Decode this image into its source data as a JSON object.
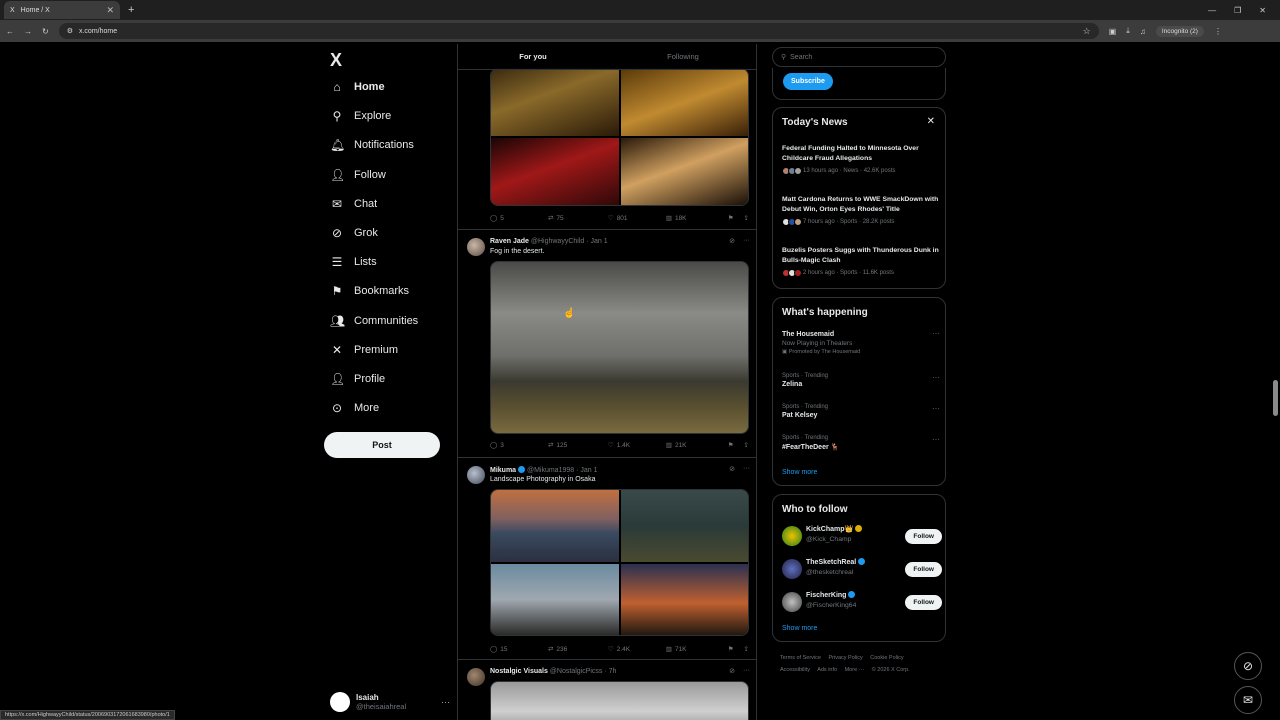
{
  "browser": {
    "tab_title": "Home / X",
    "tab_icon": "X",
    "url": "x.com/home",
    "incognito_label": "Incognito (2)",
    "status_url": "https://x.com/HighwayyChild/status/2006903172061683980/photo/1"
  },
  "nav": {
    "logo": "X",
    "items": [
      {
        "label": "Home",
        "icon": "home-icon",
        "glyph": "⌂"
      },
      {
        "label": "Explore",
        "icon": "search-icon",
        "glyph": "⚲"
      },
      {
        "label": "Notifications",
        "icon": "bell-icon",
        "glyph": "🔔︎"
      },
      {
        "label": "Follow",
        "icon": "person-add-icon",
        "glyph": "👤︎"
      },
      {
        "label": "Chat",
        "icon": "mail-icon",
        "glyph": "✉"
      },
      {
        "label": "Grok",
        "icon": "grok-icon",
        "glyph": "⊘"
      },
      {
        "label": "Lists",
        "icon": "list-icon",
        "glyph": "☰"
      },
      {
        "label": "Bookmarks",
        "icon": "bookmark-icon",
        "glyph": "⚑"
      },
      {
        "label": "Communities",
        "icon": "communities-icon",
        "glyph": "👥︎"
      },
      {
        "label": "Premium",
        "icon": "x-premium-icon",
        "glyph": "✕"
      },
      {
        "label": "Profile",
        "icon": "profile-icon",
        "glyph": "👤︎"
      },
      {
        "label": "More",
        "icon": "more-circle-icon",
        "glyph": "⊙"
      }
    ],
    "post_label": "Post",
    "account": {
      "name": "Isaiah",
      "handle": "@theisaiahreal"
    }
  },
  "feed": {
    "tabs": [
      "For you",
      "Following"
    ],
    "post0": {
      "replies": "5",
      "reposts": "75",
      "likes": "801",
      "views": "18K"
    },
    "post1": {
      "name": "Raven Jade",
      "handle": "@HighwayyChild",
      "date": "· Jan 1",
      "text": "Fog in the desert.",
      "replies": "3",
      "reposts": "125",
      "likes": "1.4K",
      "views": "21K"
    },
    "post2": {
      "name": "Mikuma",
      "handle": "@Mikuma1998",
      "date": "· Jan 1",
      "text": "Landscape Photography in Osaka",
      "replies": "15",
      "reposts": "236",
      "likes": "2.4K",
      "views": "71K"
    },
    "post3": {
      "name": "Nostalgic Visuals",
      "handle": "@NostalgicPicss",
      "date": "· 7h"
    }
  },
  "sidebar": {
    "search_placeholder": "Search",
    "subscribe_label": "Subscribe",
    "news_title": "Today's News",
    "news": [
      {
        "title": "Federal Funding Halted to Minnesota Over Childcare Fraud Allegations",
        "meta": "13 hours ago · News · 42.6K posts"
      },
      {
        "title": "Matt Cardona Returns to WWE SmackDown with Debut Win, Orton Eyes Rhodes' Title",
        "meta": "7 hours ago · Sports · 28.2K posts"
      },
      {
        "title": "Buzelis Posters Suggs with Thunderous Dunk in Bulls-Magic Clash",
        "meta": "2 hours ago · Sports · 11.6K posts"
      }
    ],
    "happening_title": "What's happening",
    "trends": [
      {
        "cat": "",
        "name": "The Housemaid",
        "sub": "Now Playing in Theaters",
        "promo": "Promoted by The Housemaid"
      },
      {
        "cat": "Sports · Trending",
        "name": "Zelina"
      },
      {
        "cat": "Sports · Trending",
        "name": "Pat Kelsey"
      },
      {
        "cat": "Sports · Trending",
        "name": "#FearTheDeer 🦌"
      }
    ],
    "show_more": "Show more",
    "wtf_title": "Who to follow",
    "who_to_follow": [
      {
        "name": "KickChamp👑",
        "handle": "@Kick_Champ",
        "button": "Follow"
      },
      {
        "name": "TheSketchReal",
        "handle": "@thesketchreal",
        "button": "Follow"
      },
      {
        "name": "FischerKing",
        "handle": "@FischerKing64",
        "button": "Follow"
      }
    ],
    "footer": [
      "Terms of Service",
      "Privacy Policy",
      "Cookie Policy",
      "Accessibility",
      "Ads info",
      "More ···",
      "© 2026 X Corp."
    ]
  }
}
